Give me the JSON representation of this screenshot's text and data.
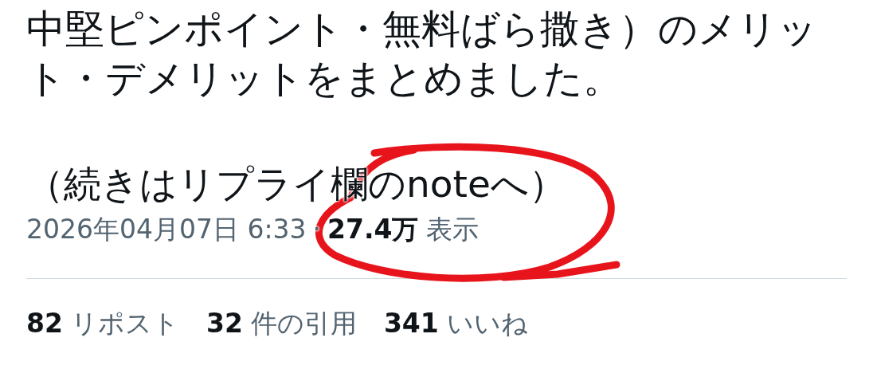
{
  "post": {
    "body_lines": [
      "中堅ピンポイント・無料ばら撒き）のメリッ",
      "ト・デメリットをまとめました。"
    ],
    "continuation": "（続きはリプライ欄のnoteへ）",
    "timestamp": "2026年04月07日 6:33",
    "separator": "·",
    "views_count": "27.4万",
    "views_label": "表示"
  },
  "stats": [
    {
      "count": "82",
      "label": "リポスト"
    },
    {
      "count": "32",
      "label": "件の引用"
    },
    {
      "count": "341",
      "label": "いいね"
    }
  ],
  "annotation": {
    "kind": "circle",
    "color": "#e8141c"
  }
}
